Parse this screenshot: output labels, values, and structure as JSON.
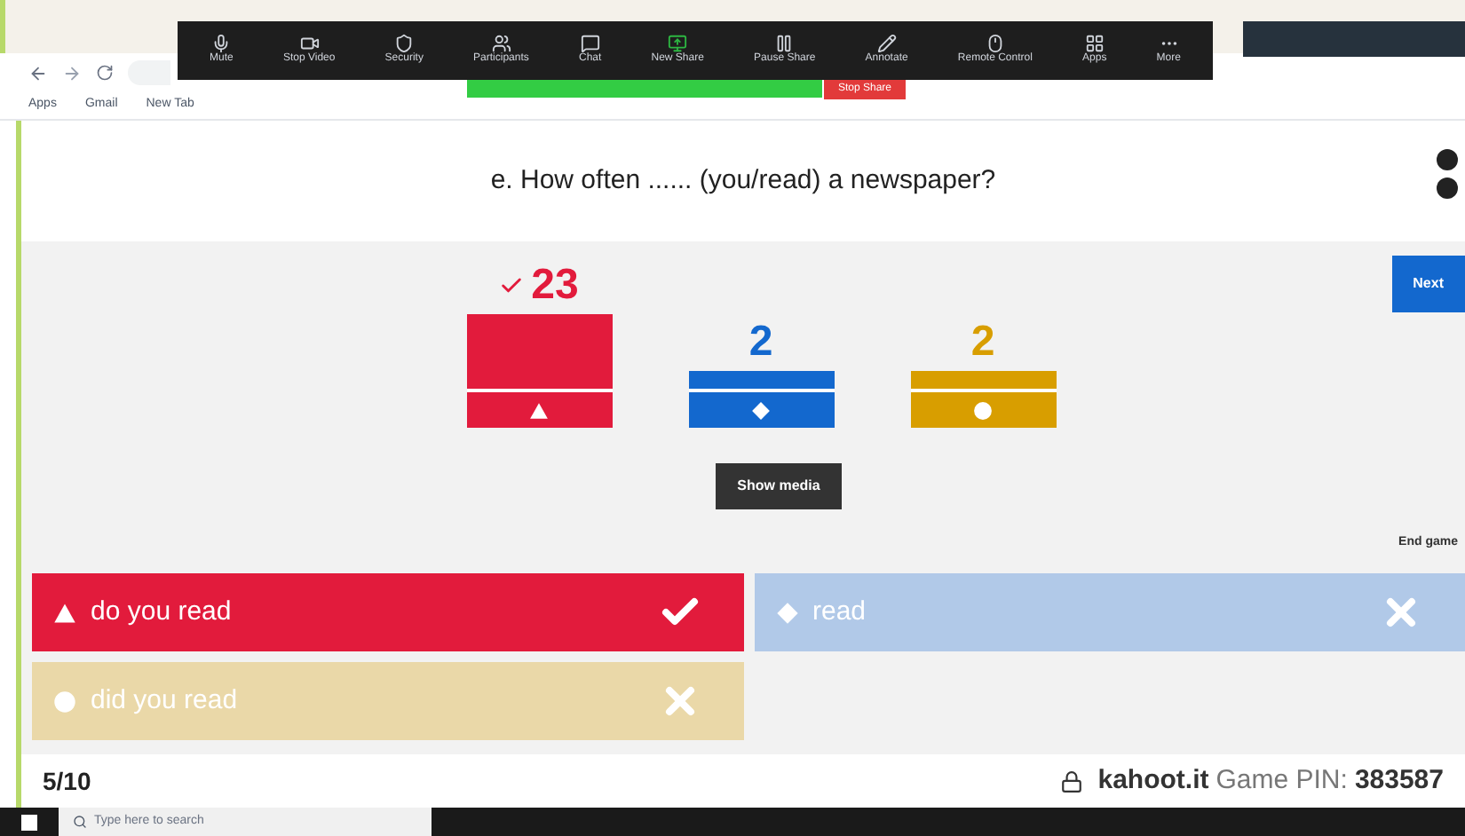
{
  "meeting_toolbar": {
    "items": [
      {
        "label": "Mute",
        "kind": "mic"
      },
      {
        "label": "Stop Video",
        "kind": "video"
      },
      {
        "label": "Security",
        "kind": "shield"
      },
      {
        "label": "Participants",
        "kind": "users"
      },
      {
        "label": "Chat",
        "kind": "chat"
      },
      {
        "label": "New Share",
        "kind": "share"
      },
      {
        "label": "Pause Share",
        "kind": "pause"
      },
      {
        "label": "Annotate",
        "kind": "pen"
      },
      {
        "label": "Remote Control",
        "kind": "mouse"
      },
      {
        "label": "Apps",
        "kind": "apps"
      },
      {
        "label": "More",
        "kind": "more"
      }
    ],
    "stop_share": "Stop Share"
  },
  "bookmarks": [
    "Apps",
    "Gmail",
    "New Tab"
  ],
  "question": "e. How often ...... (you/read) a newspaper?",
  "results": [
    {
      "count": "23",
      "correct": true,
      "color": "#e21b3c",
      "kind": "triangle"
    },
    {
      "count": "2",
      "correct": false,
      "color": "#1368ce",
      "kind": "diamond"
    },
    {
      "count": "2",
      "correct": false,
      "color": "#d89e00",
      "kind": "circle"
    }
  ],
  "show_media": "Show media",
  "next": "Next",
  "end_game": "End game",
  "answers": [
    {
      "text": "do you read",
      "correct": true,
      "color": "#e21b3c",
      "kind": "triangle"
    },
    {
      "text": "read",
      "correct": false,
      "color": "#b1c9e8",
      "kind": "diamond"
    },
    {
      "text": "did you read",
      "correct": false,
      "color": "#ead8a8",
      "kind": "circle"
    }
  ],
  "footer": {
    "progress": "5/10",
    "site": "kahoot.it",
    "pin_label": "Game PIN:",
    "pin": "383587"
  },
  "taskbar": {
    "search_placeholder": "Type here to search"
  }
}
